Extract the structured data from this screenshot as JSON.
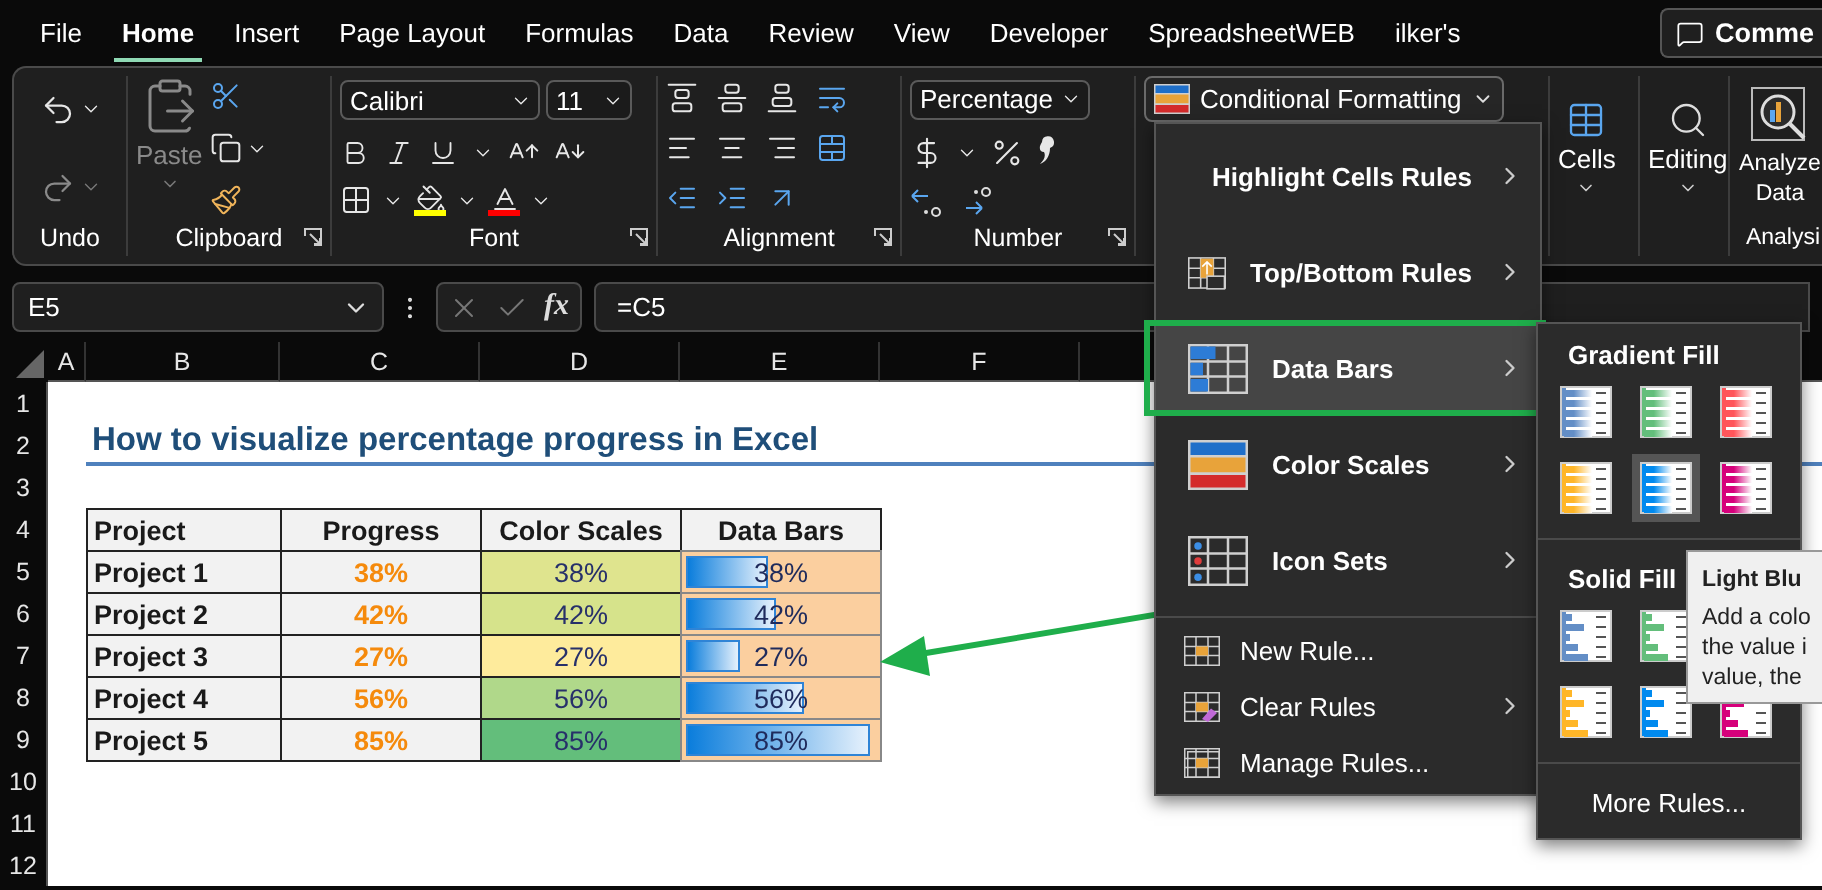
{
  "tabs": [
    {
      "label": "File",
      "selected": false
    },
    {
      "label": "Home",
      "selected": true
    },
    {
      "label": "Insert",
      "selected": false
    },
    {
      "label": "Page Layout",
      "selected": false
    },
    {
      "label": "Formulas",
      "selected": false
    },
    {
      "label": "Data",
      "selected": false
    },
    {
      "label": "Review",
      "selected": false
    },
    {
      "label": "View",
      "selected": false
    },
    {
      "label": "Developer",
      "selected": false
    },
    {
      "label": "SpreadsheetWEB",
      "selected": false
    },
    {
      "label": "ilker's",
      "selected": false
    }
  ],
  "comments_button": "Comme",
  "ribbon": {
    "undo_label": "Undo",
    "paste_label": "Paste",
    "clipboard_label": "Clipboard",
    "font_name": "Calibri",
    "font_size": "11",
    "font_label": "Font",
    "alignment_label": "Alignment",
    "number_format": "Percentage",
    "number_label": "Number",
    "conditional_formatting": "Conditional Formatting",
    "cells_label": "Cells",
    "editing_label": "Editing",
    "analyze_data": "Analyze Data",
    "analysis_label": "Analysi"
  },
  "formula_bar": {
    "name_box": "E5",
    "fx": "fx",
    "formula": "=C5"
  },
  "sheet": {
    "columns": [
      "A",
      "B",
      "C",
      "D",
      "E",
      "F"
    ],
    "row_numbers": [
      "1",
      "2",
      "3",
      "4",
      "5",
      "6",
      "7",
      "8",
      "9",
      "10",
      "11",
      "12"
    ],
    "title": "How to visualize percentage progress in Excel",
    "table": {
      "headers": [
        "Project",
        "Progress",
        "Color Scales",
        "Data Bars"
      ],
      "rows": [
        {
          "project": "Project 1",
          "progress": "38%",
          "scale_text": "38%",
          "color": "#dfe48e",
          "bar_text": "38%",
          "level": 0.45
        },
        {
          "project": "Project 2",
          "progress": "42%",
          "scale_text": "42%",
          "color": "#d6e38b",
          "bar_text": "42%",
          "level": 0.49
        },
        {
          "project": "Project 3",
          "progress": "27%",
          "scale_text": "27%",
          "color": "#feeb9c",
          "bar_text": "27%",
          "level": 0.31
        },
        {
          "project": "Project 4",
          "progress": "56%",
          "scale_text": "56%",
          "color": "#b0d88a",
          "bar_text": "56%",
          "level": 0.64
        },
        {
          "project": "Project 5",
          "progress": "85%",
          "scale_text": "85%",
          "color": "#63be7b",
          "bar_text": "85%",
          "level": 0.97
        }
      ]
    }
  },
  "conditional_menu": {
    "rule_items": [
      {
        "label": "Highlight Cells Rules",
        "kind": "highlight",
        "highlighted": false
      },
      {
        "label": "Top/Bottom Rules",
        "kind": "topbottom",
        "highlighted": false
      },
      {
        "label": "Data Bars",
        "kind": "databars",
        "highlighted": true
      },
      {
        "label": "Color Scales",
        "kind": "colorscales",
        "highlighted": false
      },
      {
        "label": "Icon Sets",
        "kind": "iconsets",
        "highlighted": false
      }
    ],
    "action_items": [
      {
        "label": "New Rule...",
        "kind": "newrule",
        "submenu": false
      },
      {
        "label": "Clear Rules",
        "kind": "clearrules",
        "submenu": true
      },
      {
        "label": "Manage Rules...",
        "kind": "managerules",
        "submenu": false
      }
    ]
  },
  "data_bars_menu": {
    "gradient_title": "Gradient Fill",
    "gradient_fill": [
      {
        "color": "#638ec6",
        "selected": false
      },
      {
        "color": "#63be7b",
        "selected": false
      },
      {
        "color": "#ff555a",
        "selected": false
      },
      {
        "color": "#ffb628",
        "selected": false
      },
      {
        "color": "#008aef",
        "selected": true
      },
      {
        "color": "#d6007b",
        "selected": false
      }
    ],
    "solid_title": "Solid Fill",
    "solid_fill": [
      {
        "color": "#638ec6",
        "selected": false
      },
      {
        "color": "#63be7b",
        "selected": false
      },
      {
        "color": "#ffb628",
        "selected": false
      },
      {
        "color": "#008aef",
        "selected": false
      },
      {
        "color": "#d6007b",
        "selected": false
      }
    ],
    "more_rules": "More Rules..."
  },
  "tooltip": {
    "title": "Light Blu",
    "lines": [
      "Add a colo",
      "the value i",
      "value, the"
    ]
  }
}
